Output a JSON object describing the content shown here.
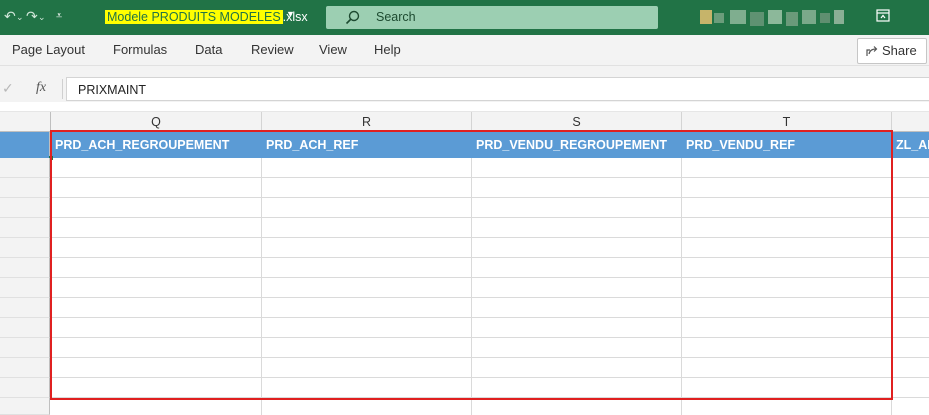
{
  "titlebar": {
    "filename_highlight": "Modele PRODUITS MODELES",
    "filename_ext": ".xlsx",
    "search_label": "Search",
    "bg_color": "#217346"
  },
  "ribbon": {
    "tabs": [
      "Page Layout",
      "Formulas",
      "Data",
      "Review",
      "View",
      "Help"
    ],
    "share_label": "Share"
  },
  "formula_bar": {
    "fx_label": "fx",
    "value": "PRIXMAINT"
  },
  "grid": {
    "columns": [
      "Q",
      "R",
      "S",
      "T"
    ],
    "header_row": [
      "PRD_ACH_REGROUPEMENT",
      "PRD_ACH_REF",
      "PRD_VENDU_REGROUPEMENT",
      "PRD_VENDU_REF",
      "ZL_AL"
    ],
    "header_fill_color": "#5b9bd5",
    "selection_color": "#e02020"
  }
}
